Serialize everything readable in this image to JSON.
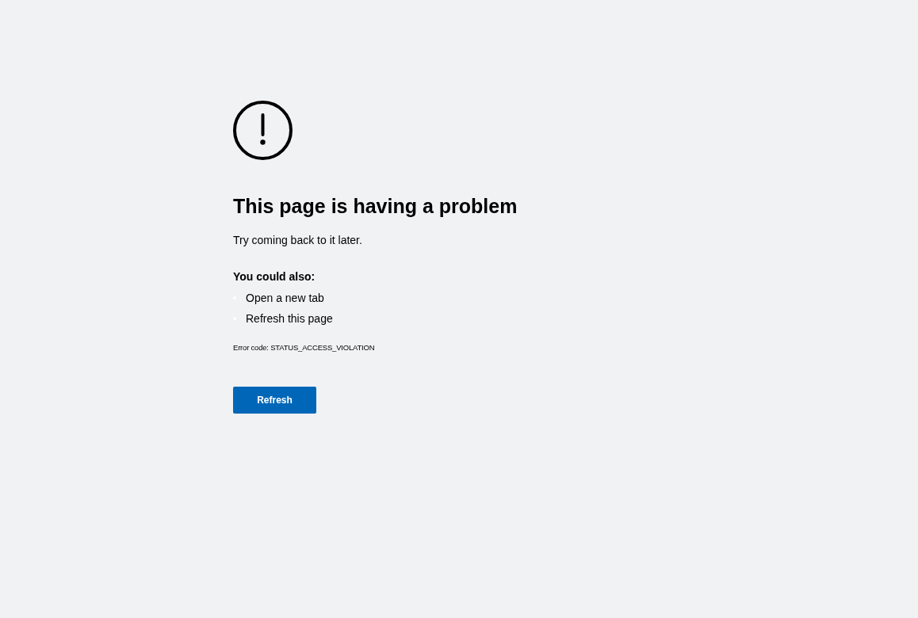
{
  "heading": "This page is having a problem",
  "message": "Try coming back to it later.",
  "suggestions": {
    "title": "You could also:",
    "items": [
      "Open a new tab",
      "Refresh this page"
    ]
  },
  "error_code": "Error code: STATUS_ACCESS_VIOLATION",
  "button": "Refresh"
}
